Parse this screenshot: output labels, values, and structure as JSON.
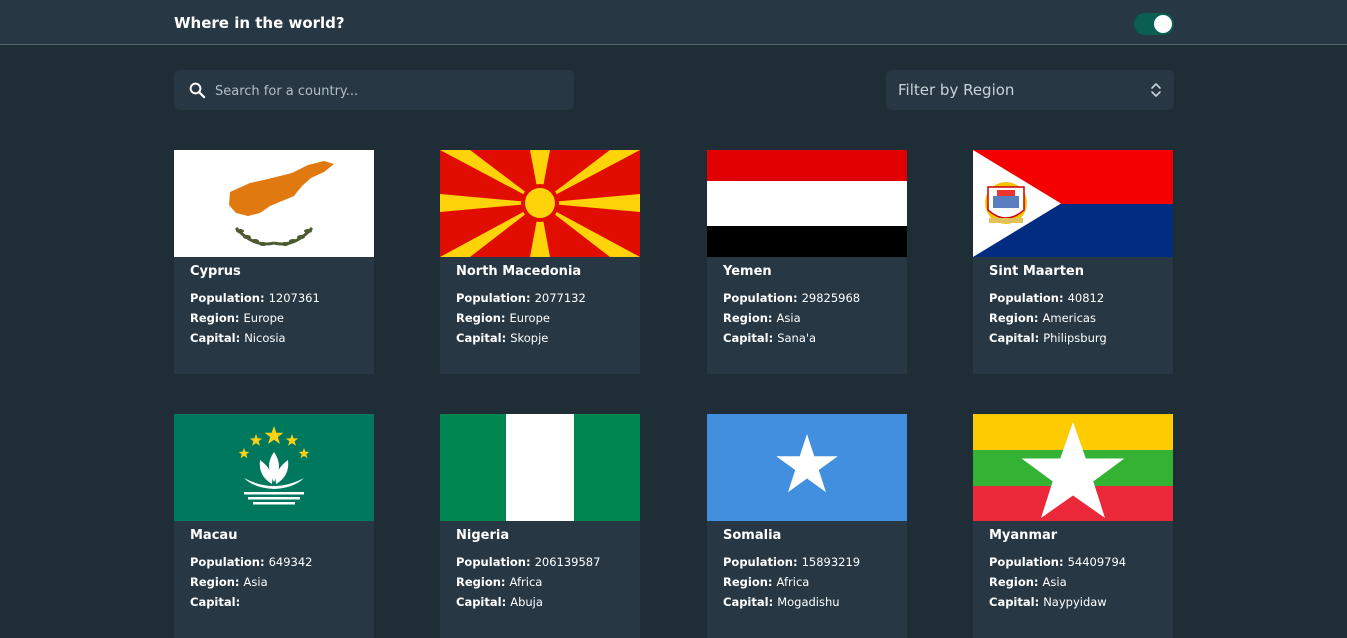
{
  "header": {
    "title": "Where in the world?",
    "theme_toggle": "dark-mode-toggle"
  },
  "search": {
    "placeholder": "Search for a country...",
    "value": "",
    "icon": "search-icon"
  },
  "filter": {
    "label": "Filter by Region",
    "icon": "chevron-up-down-icon"
  },
  "labels": {
    "population": "Population:",
    "region": "Region:",
    "capital": "Capital:"
  },
  "countries": [
    {
      "name": "Cyprus",
      "population": "1207361",
      "region": "Europe",
      "capital": "Nicosia"
    },
    {
      "name": "North Macedonia",
      "population": "2077132",
      "region": "Europe",
      "capital": "Skopje"
    },
    {
      "name": "Yemen",
      "population": "29825968",
      "region": "Asia",
      "capital": "Sana'a"
    },
    {
      "name": "Sint Maarten",
      "population": "40812",
      "region": "Americas",
      "capital": "Philipsburg"
    },
    {
      "name": "Macau",
      "population": "649342",
      "region": "Asia",
      "capital": ""
    },
    {
      "name": "Nigeria",
      "population": "206139587",
      "region": "Africa",
      "capital": "Abuja"
    },
    {
      "name": "Somalia",
      "population": "15893219",
      "region": "Africa",
      "capital": "Mogadishu"
    },
    {
      "name": "Myanmar",
      "population": "54409794",
      "region": "Asia",
      "capital": "Naypyidaw"
    }
  ],
  "colors": {
    "background": "#1f2d37",
    "element": "#273844",
    "toggle_on": "#0a5e52"
  }
}
